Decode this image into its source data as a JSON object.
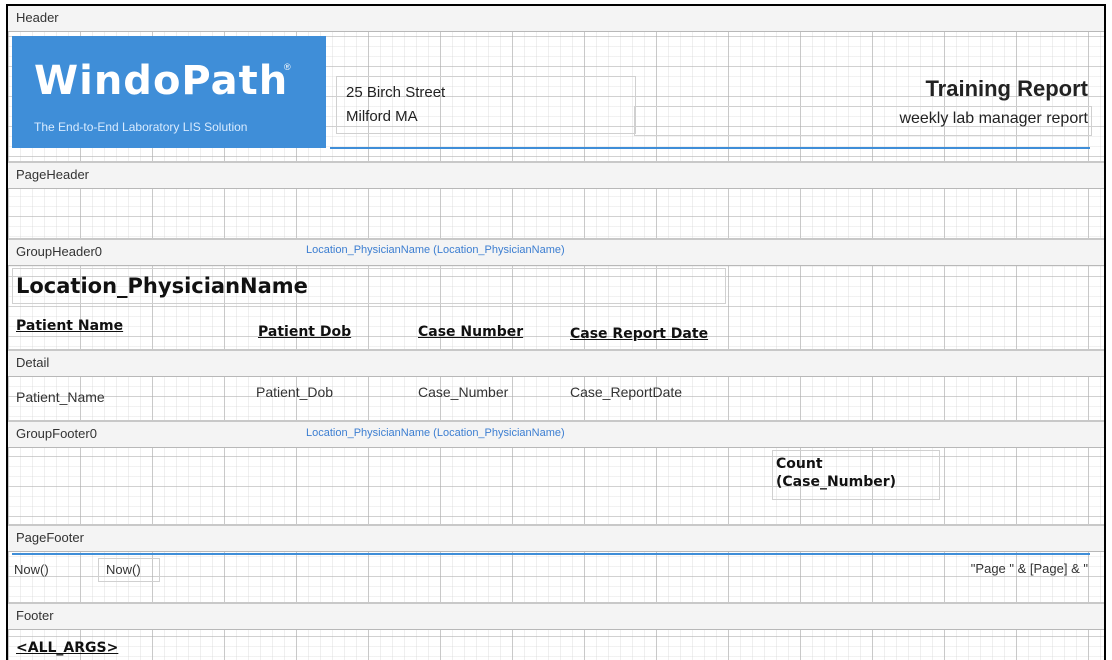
{
  "bands": {
    "header": "Header",
    "page_header": "PageHeader",
    "group_header": "GroupHeader0",
    "detail": "Detail",
    "group_footer": "GroupFooter0",
    "page_footer": "PageFooter",
    "footer": "Footer"
  },
  "logo": {
    "title": "WindoPath",
    "registered_mark": "®",
    "tagline": "The End-to-End Laboratory LIS Solution"
  },
  "address": {
    "line1": "25 Birch Street",
    "line2": "Milford MA"
  },
  "report": {
    "title": "Training Report",
    "subtitle": "weekly lab manager report"
  },
  "group_header": {
    "group_field": "Location_PhysicianName (Location_PhysicianName)",
    "group_title": "Location_PhysicianName",
    "columns": [
      "Patient Name",
      "Patient Dob",
      "Case Number",
      "Case Report Date"
    ]
  },
  "detail": {
    "fields": [
      "Patient_Name",
      "Patient_Dob",
      "Case_Number",
      "Case_ReportDate"
    ]
  },
  "group_footer": {
    "group_field": "Location_PhysicianName (Location_PhysicianName)",
    "count_line1": "Count",
    "count_line2": "(Case_Number)"
  },
  "page_footer": {
    "now1": "Now()",
    "now2": "Now()",
    "page_expr": "\"Page \" & [Page] & \""
  },
  "footer": {
    "args": "<ALL_ARGS>"
  },
  "colors": {
    "accent": "#3f8ed8",
    "link_blue": "#3c7ed1",
    "band_bg": "#f4f4f4"
  }
}
